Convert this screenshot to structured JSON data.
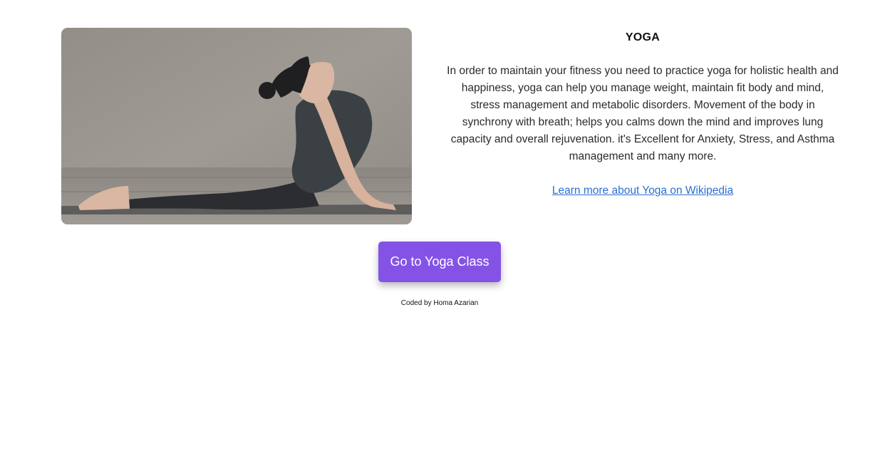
{
  "card": {
    "image_alt": "Woman practicing yoga cobra pose",
    "title": "YOGA",
    "description": "In order to maintain your fitness you need to practice yoga for holistic health and happiness, yoga can help you manage weight, maintain fit body and mind, stress management and metabolic disorders. Movement of the body in synchrony with breath; helps you calms down the mind and improves lung capacity and overall rejuvenation. it's Excellent for Anxiety, Stress, and Asthma management and many more.",
    "link_text": "Learn more about Yoga on Wikipedia"
  },
  "cta": {
    "label": "Go to Yoga Class",
    "color": "#8453e6"
  },
  "footer": {
    "credit": "Coded by Homa Azarian"
  },
  "colors": {
    "link": "#2c6fd1",
    "text": "#2b2b2b"
  }
}
